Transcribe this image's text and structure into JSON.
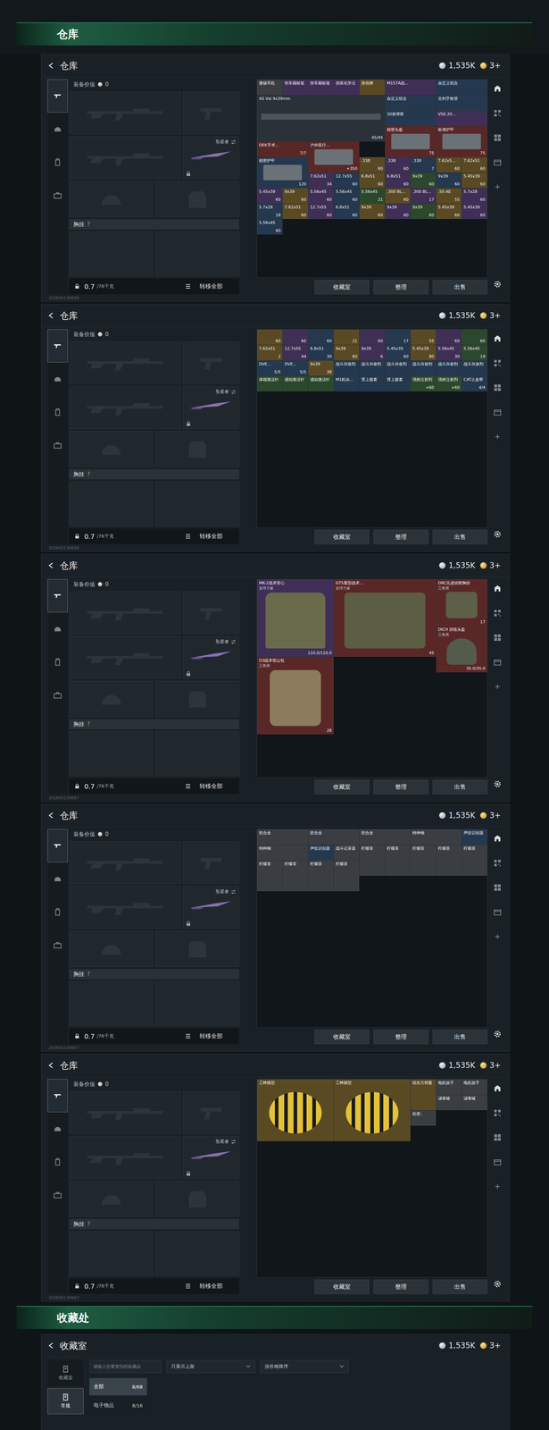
{
  "top_title": "仓库",
  "warehouse": {
    "title": "仓库",
    "currency": "1,535K",
    "coins": "3+",
    "equipment_value_label": "装备价值",
    "equipment_value": "0",
    "knife": "坠星者",
    "rig_label": "胸挂",
    "rig_value": "?",
    "weight": "0.7",
    "weight_max": "/76千克",
    "transfer_all": "转移全部",
    "actions": [
      "收藏室",
      "整理",
      "出售"
    ],
    "tabs": [
      {
        "selected": true
      },
      {
        "selected": false
      },
      {
        "selected": false
      },
      {
        "selected": false
      }
    ]
  },
  "pages": [
    {
      "watermark": "202605130658",
      "items": [
        {
          "name": "微秘耳机",
          "kind": "small",
          "color": "#3a3d41"
        },
        {
          "name": "快车厢标签",
          "kind": "small",
          "color": "#3f2f56"
        },
        {
          "name": "快车厢标签",
          "kind": "small",
          "color": "#3f2f56"
        },
        {
          "name": "伪装化学元",
          "kind": "small",
          "color": "#3f2f56"
        },
        {
          "name": "身份牌",
          "kind": "small",
          "color": "#5a4a24"
        },
        {
          "name": "M157A战...",
          "kind": "wide",
          "color": "#3f2f56"
        },
        {
          "name": "自定义组合",
          "kind": "wide",
          "color": "#24384f"
        },
        {
          "name": "AS Val 9x39mm",
          "count": "45/45",
          "kind": "weapon",
          "color": "#2a3138"
        },
        {
          "name": "自定义组合",
          "kind": "wide",
          "color": "#24384f"
        },
        {
          "name": "击剑手枪管",
          "kind": "wide",
          "color": "#24384f"
        },
        {
          "name": "30发弹匣",
          "kind": "wide",
          "color": "#24384f"
        },
        {
          "name": "VSS 20...",
          "kind": "wide",
          "color": "#3f2f56"
        },
        {
          "name": "精密头盔",
          "count": "75",
          "kind": "box",
          "color": "#5a2727"
        },
        {
          "name": "标准护甲",
          "count": "75",
          "kind": "box",
          "color": "#5a2727"
        },
        {
          "name": "DEK手术...",
          "count": "7/7",
          "kind": "wide",
          "color": "#5a2727"
        },
        {
          "name": "户外医疗...",
          "count": "+350",
          "kind": "box",
          "color": "#5a2727"
        },
        {
          "name": "精密护甲",
          "count": "120",
          "kind": "box",
          "color": "#24384f"
        },
        {
          "name": ".338",
          "count": "60",
          "kind": "small",
          "color": "#5a4a24"
        },
        {
          "name": ".338",
          "count": "60",
          "kind": "small",
          "color": "#3f2f56"
        },
        {
          "name": ".338",
          "count": "7",
          "kind": "small",
          "color": "#24384f"
        },
        {
          "name": "7.62x5...",
          "count": "60",
          "kind": "small",
          "color": "#5a4a24"
        },
        {
          "name": "7.62x51",
          "count": "60",
          "kind": "small",
          "color": "#5a4a24"
        },
        {
          "name": "7.62x51",
          "count": "34",
          "kind": "small",
          "color": "#3f2f56"
        },
        {
          "name": "12.7x55",
          "count": "60",
          "kind": "small",
          "color": "#24384f"
        },
        {
          "name": "6.8x51",
          "count": "60",
          "kind": "small",
          "color": "#5a4a24"
        },
        {
          "name": "6.8x51",
          "count": "60",
          "kind": "small",
          "color": "#3f2f56"
        },
        {
          "name": "9x39",
          "count": "60",
          "kind": "small",
          "color": "#2c482c"
        },
        {
          "name": "9x39",
          "count": "60",
          "kind": "small",
          "color": "#24384f"
        },
        {
          "name": "5.45x39",
          "count": "60",
          "kind": "small",
          "color": "#5a4a24"
        },
        {
          "name": "5.45x39",
          "count": "60",
          "kind": "small",
          "color": "#3f2f56"
        },
        {
          "name": "9x39",
          "count": "60",
          "kind": "small",
          "color": "#5a4a24"
        },
        {
          "name": "5.56x45",
          "count": "60",
          "kind": "small",
          "color": "#3f2f56"
        },
        {
          "name": "5.56x45",
          "count": "60",
          "kind": "small",
          "color": "#24384f"
        },
        {
          "name": "5.56x45",
          "count": "21",
          "kind": "small",
          "color": "#2c482c"
        },
        {
          "name": ".300 BL...",
          "count": "60",
          "kind": "small",
          "color": "#5a4a24"
        },
        {
          "name": ".300 BL...",
          "count": "17",
          "kind": "small",
          "color": "#3f2f56"
        },
        {
          "name": ".50 AE",
          "count": "55",
          "kind": "small",
          "color": "#5a4a24"
        },
        {
          "name": "5.7x28",
          "count": "60",
          "kind": "small",
          "color": "#3f2f56"
        },
        {
          "name": "5.7x28",
          "count": "18",
          "kind": "small",
          "color": "#24384f"
        },
        {
          "name": "7.62x51",
          "count": "60",
          "kind": "small",
          "color": "#5a4a24"
        },
        {
          "name": "12.7x55",
          "count": "60",
          "kind": "small",
          "color": "#3f2f56"
        },
        {
          "name": "6.8x51",
          "count": "60",
          "kind": "small",
          "color": "#24384f"
        },
        {
          "name": "9x39",
          "count": "60",
          "kind": "small",
          "color": "#5a4a24"
        },
        {
          "name": "9x39",
          "count": "60",
          "kind": "small",
          "color": "#3f2f56"
        },
        {
          "name": "9x39",
          "count": "60",
          "kind": "small",
          "color": "#2c482c"
        },
        {
          "name": "5.45x39",
          "count": "60",
          "kind": "small",
          "color": "#5a4a24"
        },
        {
          "name": "5.45x39",
          "count": "60",
          "kind": "small",
          "color": "#3f2f56"
        },
        {
          "name": "5.56x45",
          "count": "60",
          "kind": "small",
          "color": "#24384f"
        }
      ]
    },
    {
      "watermark": "202605130658",
      "items": [
        {
          "count": "60",
          "kind": "small",
          "color": "#5a4a24"
        },
        {
          "count": "60",
          "kind": "small",
          "color": "#3f2f56"
        },
        {
          "count": "60",
          "kind": "small",
          "color": "#24384f"
        },
        {
          "count": "21",
          "kind": "small",
          "color": "#5a4a24"
        },
        {
          "count": "60",
          "kind": "small",
          "color": "#3f2f56"
        },
        {
          "count": "17",
          "kind": "small",
          "color": "#24384f"
        },
        {
          "count": "55",
          "kind": "small",
          "color": "#5a4a24"
        },
        {
          "count": "60",
          "kind": "small",
          "color": "#3f2f56"
        },
        {
          "count": "60",
          "kind": "small",
          "color": "#2c482c"
        },
        {
          "name": "7.62x51",
          "count": "2",
          "kind": "small",
          "color": "#5a4a24"
        },
        {
          "name": "12.7x55",
          "count": "44",
          "kind": "small",
          "color": "#3f2f56"
        },
        {
          "name": "6.8x51",
          "count": "30",
          "kind": "small",
          "color": "#24384f"
        },
        {
          "name": "9x39",
          "count": "60",
          "kind": "small",
          "color": "#5a4a24"
        },
        {
          "name": "9x39",
          "count": "6",
          "kind": "small",
          "color": "#3f2f56"
        },
        {
          "name": "5.45x39",
          "count": "60",
          "kind": "small",
          "color": "#24384f"
        },
        {
          "name": "5.45x39",
          "count": "80",
          "kind": "small",
          "color": "#5a4a24"
        },
        {
          "name": "5.56x45",
          "count": "30",
          "kind": "small",
          "color": "#3f2f56"
        },
        {
          "name": "5.56x45",
          "count": "19",
          "kind": "small",
          "color": "#2c482c"
        },
        {
          "name": "DVE...",
          "count": "5/5",
          "kind": "small",
          "color": "#24384f"
        },
        {
          "name": "DVE...",
          "count": "5/5",
          "kind": "small",
          "color": "#24384f"
        },
        {
          "name": "9x39",
          "count": "38",
          "kind": "small",
          "color": "#5a4a24"
        },
        {
          "name": "战斗兴奋剂",
          "kind": "small",
          "color": "#24384f"
        },
        {
          "name": "战斗兴奋剂",
          "kind": "small",
          "color": "#24384f"
        },
        {
          "name": "战斗兴奋剂",
          "kind": "small",
          "color": "#24384f"
        },
        {
          "name": "战斗兴奋剂",
          "kind": "small",
          "color": "#24384f"
        },
        {
          "name": "战斗兴奋剂",
          "kind": "small",
          "color": "#24384f"
        },
        {
          "name": "战斗兴奋剂",
          "kind": "small",
          "color": "#24384f"
        },
        {
          "name": "体能激活针",
          "kind": "small",
          "color": "#2c482c"
        },
        {
          "name": "感知激活针",
          "kind": "small",
          "color": "#2c482c"
        },
        {
          "name": "感知激活针",
          "kind": "small",
          "color": "#2c482c"
        },
        {
          "name": "M1机动...",
          "kind": "small",
          "color": "#24384f"
        },
        {
          "name": "肾上腺素",
          "kind": "small",
          "color": "#24384f"
        },
        {
          "name": "肾上腺素",
          "kind": "small",
          "color": "#24384f"
        },
        {
          "name": "强效注射剂",
          "count": "+60",
          "kind": "small",
          "color": "#2c482c"
        },
        {
          "name": "强效注射剂",
          "count": "+60",
          "kind": "small",
          "color": "#2c482c"
        },
        {
          "name": "CAT止血带",
          "count": "4/4",
          "kind": "small",
          "color": "#24384f"
        }
      ]
    },
    {
      "watermark": "202605130657",
      "items": [
        {
          "name": "MK-2战术背心",
          "sub": "全球力量",
          "count": "110.0/110.0",
          "kind": "vest",
          "color": "#3f2f56"
        },
        {
          "name": "GT5重型战术...",
          "sub": "全球力量",
          "count": "45",
          "kind": "heavy",
          "color": "#5a2727"
        },
        {
          "name": "DRC先进侦察胸挂",
          "sub": "三角洲",
          "count": "17",
          "kind": "rig",
          "color": "#5a2727"
        },
        {
          "name": "DICH 训练头盔",
          "sub": "三角洲",
          "count": "35.0/35.0",
          "kind": "helmet",
          "color": "#5a2727"
        },
        {
          "name": "D3战术登山包",
          "sub": "三角洲",
          "count": "28",
          "kind": "backpack",
          "color": "#5a2727"
        }
      ]
    },
    {
      "watermark": "202605130657",
      "items": [
        {
          "name": "软合金",
          "kind": "wide",
          "color": "#3a3d41"
        },
        {
          "name": "软合金",
          "kind": "wide",
          "color": "#3a3d41"
        },
        {
          "name": "软合金",
          "kind": "wide",
          "color": "#3a3d41"
        },
        {
          "name": "特种钢",
          "kind": "wide",
          "color": "#3a3d41"
        },
        {
          "name": "声纹识别器",
          "kind": "small",
          "color": "#24384f"
        },
        {
          "name": "特种钢",
          "kind": "wide",
          "color": "#3a3d41"
        },
        {
          "name": "声纹识别器",
          "kind": "small",
          "color": "#24384f"
        },
        {
          "name": "战斗记录器",
          "kind": "small",
          "color": "#3a3d41"
        },
        {
          "name": "柠檬茶",
          "kind": "tall",
          "color": "#3a3d41"
        },
        {
          "name": "柠檬茶",
          "kind": "tall",
          "color": "#3a3d41"
        },
        {
          "name": "柠檬茶",
          "kind": "tall",
          "color": "#3a3d41"
        },
        {
          "name": "柠檬茶",
          "kind": "tall",
          "color": "#3a3d41"
        },
        {
          "name": "柠檬茶",
          "kind": "tall",
          "color": "#3a3d41"
        },
        {
          "name": "柠檬茶",
          "kind": "tall",
          "color": "#3a3d41"
        },
        {
          "name": "柠檬茶",
          "kind": "tall",
          "color": "#3a3d41"
        },
        {
          "name": "柠檬茶",
          "kind": "tall",
          "color": "#3a3d41"
        },
        {
          "name": "柠檬茶",
          "kind": "tall",
          "color": "#3a3d41"
        }
      ]
    },
    {
      "watermark": "202605130657",
      "items": [
        {
          "name": "工蜂模型",
          "kind": "model",
          "color": "#5a4a24"
        },
        {
          "name": "工蜂模型",
          "kind": "model",
          "color": "#5a4a24"
        },
        {
          "name": "组长方档案",
          "kind": "tall",
          "color": "#5a4a24"
        },
        {
          "name": "电机扳手",
          "kind": "small",
          "color": "#3a3d41"
        },
        {
          "name": "电机扳手",
          "kind": "small",
          "color": "#3a3d41"
        },
        {
          "name": "滤毒罐",
          "kind": "small",
          "color": "#3a3d41"
        },
        {
          "name": "滤毒罐",
          "kind": "small",
          "color": "#3a3d41"
        },
        {
          "name": "机密..",
          "kind": "small",
          "color": "#3a3d41"
        }
      ]
    }
  ],
  "collection": {
    "section_title": "收藏处",
    "title": "收藏室",
    "currency": "1,535K",
    "coins": "3+",
    "nav": [
      {
        "label": "收藏室",
        "selected": false
      },
      {
        "label": "常规",
        "selected": true
      }
    ],
    "search_placeholder": "请输入您要查找的收藏品",
    "filters": [
      "只显示上架",
      "按价格降序"
    ],
    "categories": [
      {
        "label": "全部",
        "count": "8/68",
        "selected": true
      },
      {
        "label": "电子物品",
        "count": "8/16",
        "selected": false
      }
    ]
  }
}
